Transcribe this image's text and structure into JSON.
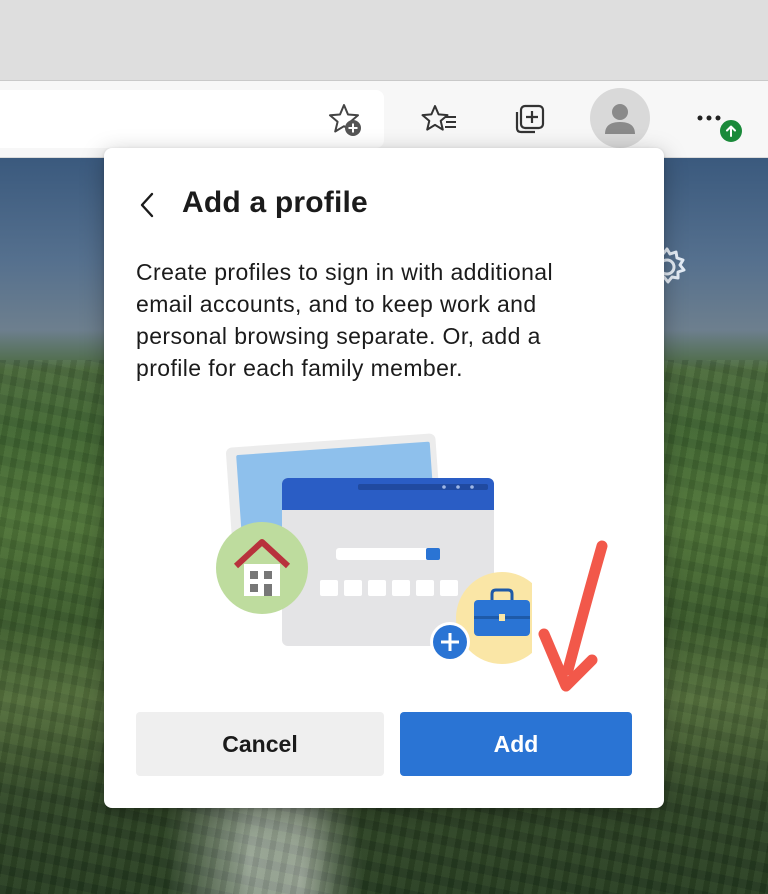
{
  "dialog": {
    "title": "Add a profile",
    "description": "Create profiles to sign in with additional email accounts, and to keep work and personal browsing separate. Or, add a profile for each family member.",
    "cancel_label": "Cancel",
    "add_label": "Add"
  },
  "toolbar": {
    "icons": [
      "add-favorite-icon",
      "favorites-icon",
      "collections-icon",
      "profile-avatar",
      "more-options-icon"
    ]
  },
  "colors": {
    "accent": "#2a74d4",
    "update_badge": "#1a8a3a",
    "annotation_arrow": "#f2584a"
  }
}
